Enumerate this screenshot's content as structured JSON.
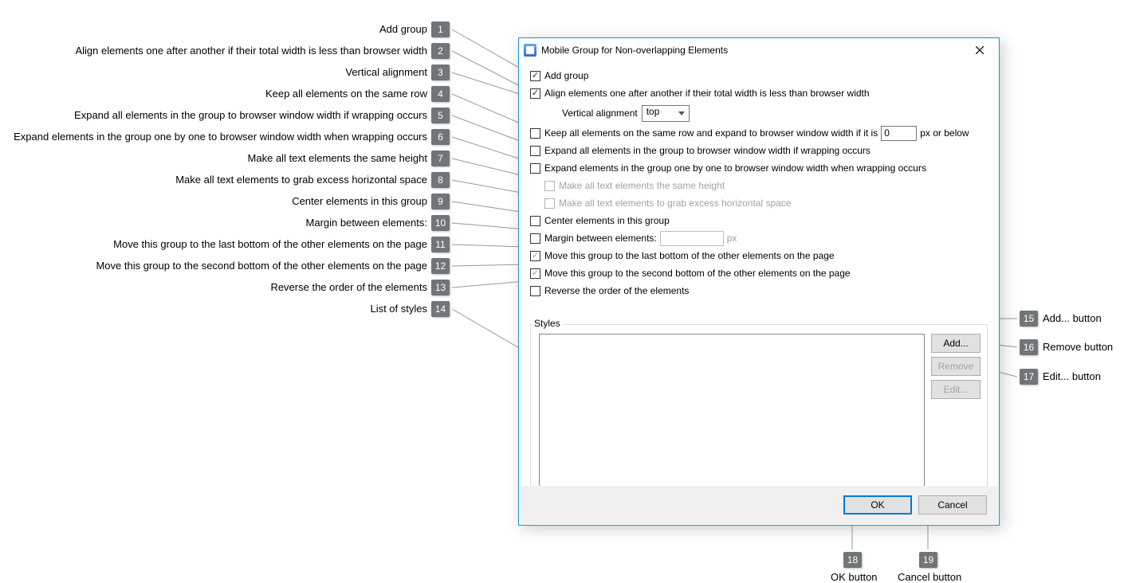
{
  "annotations": {
    "left": [
      {
        "n": "1",
        "t": "Add group"
      },
      {
        "n": "2",
        "t": "Align elements one after another if their total width is less than browser width"
      },
      {
        "n": "3",
        "t": "Vertical alignment"
      },
      {
        "n": "4",
        "t": "Keep all elements on the same row"
      },
      {
        "n": "5",
        "t": "Expand all elements in the group to browser window width if wrapping occurs"
      },
      {
        "n": "6",
        "t": "Expand elements in the group one by one to browser window width when wrapping occurs"
      },
      {
        "n": "7",
        "t": "Make all text elements the same height"
      },
      {
        "n": "8",
        "t": "Make all text elements to grab excess horizontal space"
      },
      {
        "n": "9",
        "t": "Center elements in this group"
      },
      {
        "n": "10",
        "t": "Margin between elements:"
      },
      {
        "n": "11",
        "t": "Move this group to the last bottom of the other elements on the page"
      },
      {
        "n": "12",
        "t": "Move this group to the second bottom of the other elements on the page"
      },
      {
        "n": "13",
        "t": "Reverse the order of the elements"
      },
      {
        "n": "14",
        "t": "List of styles"
      }
    ],
    "right": [
      {
        "n": "15",
        "t": "Add... button"
      },
      {
        "n": "16",
        "t": "Remove button"
      },
      {
        "n": "17",
        "t": "Edit... button"
      },
      {
        "n": "18",
        "t": "OK button"
      },
      {
        "n": "19",
        "t": "Cancel button"
      }
    ]
  },
  "dialog": {
    "title": "Mobile Group for Non-overlapping Elements",
    "addGroup": "Add group",
    "alignAfter": "Align elements one after another if their total width is less than browser width",
    "valign_label": "Vertical alignment",
    "valign_value": "top",
    "keepSameRow": "Keep all elements on the same row and expand to browser window width if it is",
    "keepSameRowValue": "0",
    "keepSameRowUnit": "px or below",
    "expandAll": "Expand all elements in the group to browser window width if wrapping occurs",
    "expandOneByOne": "Expand elements in the group one by one to browser window width when wrapping occurs",
    "sameHeight": "Make all text elements the same height",
    "grabExcess": "Make all text elements to grab excess horizontal space",
    "center": "Center elements in this group",
    "margin_label": "Margin between elements:",
    "margin_unit": "px",
    "moveLast": "Move this group to the last bottom of the other elements on the page",
    "moveSecond": "Move this group to the second bottom of the other elements on the page",
    "reverse": "Reverse the order of the elements",
    "styles_label": "Styles",
    "btn_add": "Add...",
    "btn_remove": "Remove",
    "btn_edit": "Edit...",
    "btn_ok": "OK",
    "btn_cancel": "Cancel"
  }
}
